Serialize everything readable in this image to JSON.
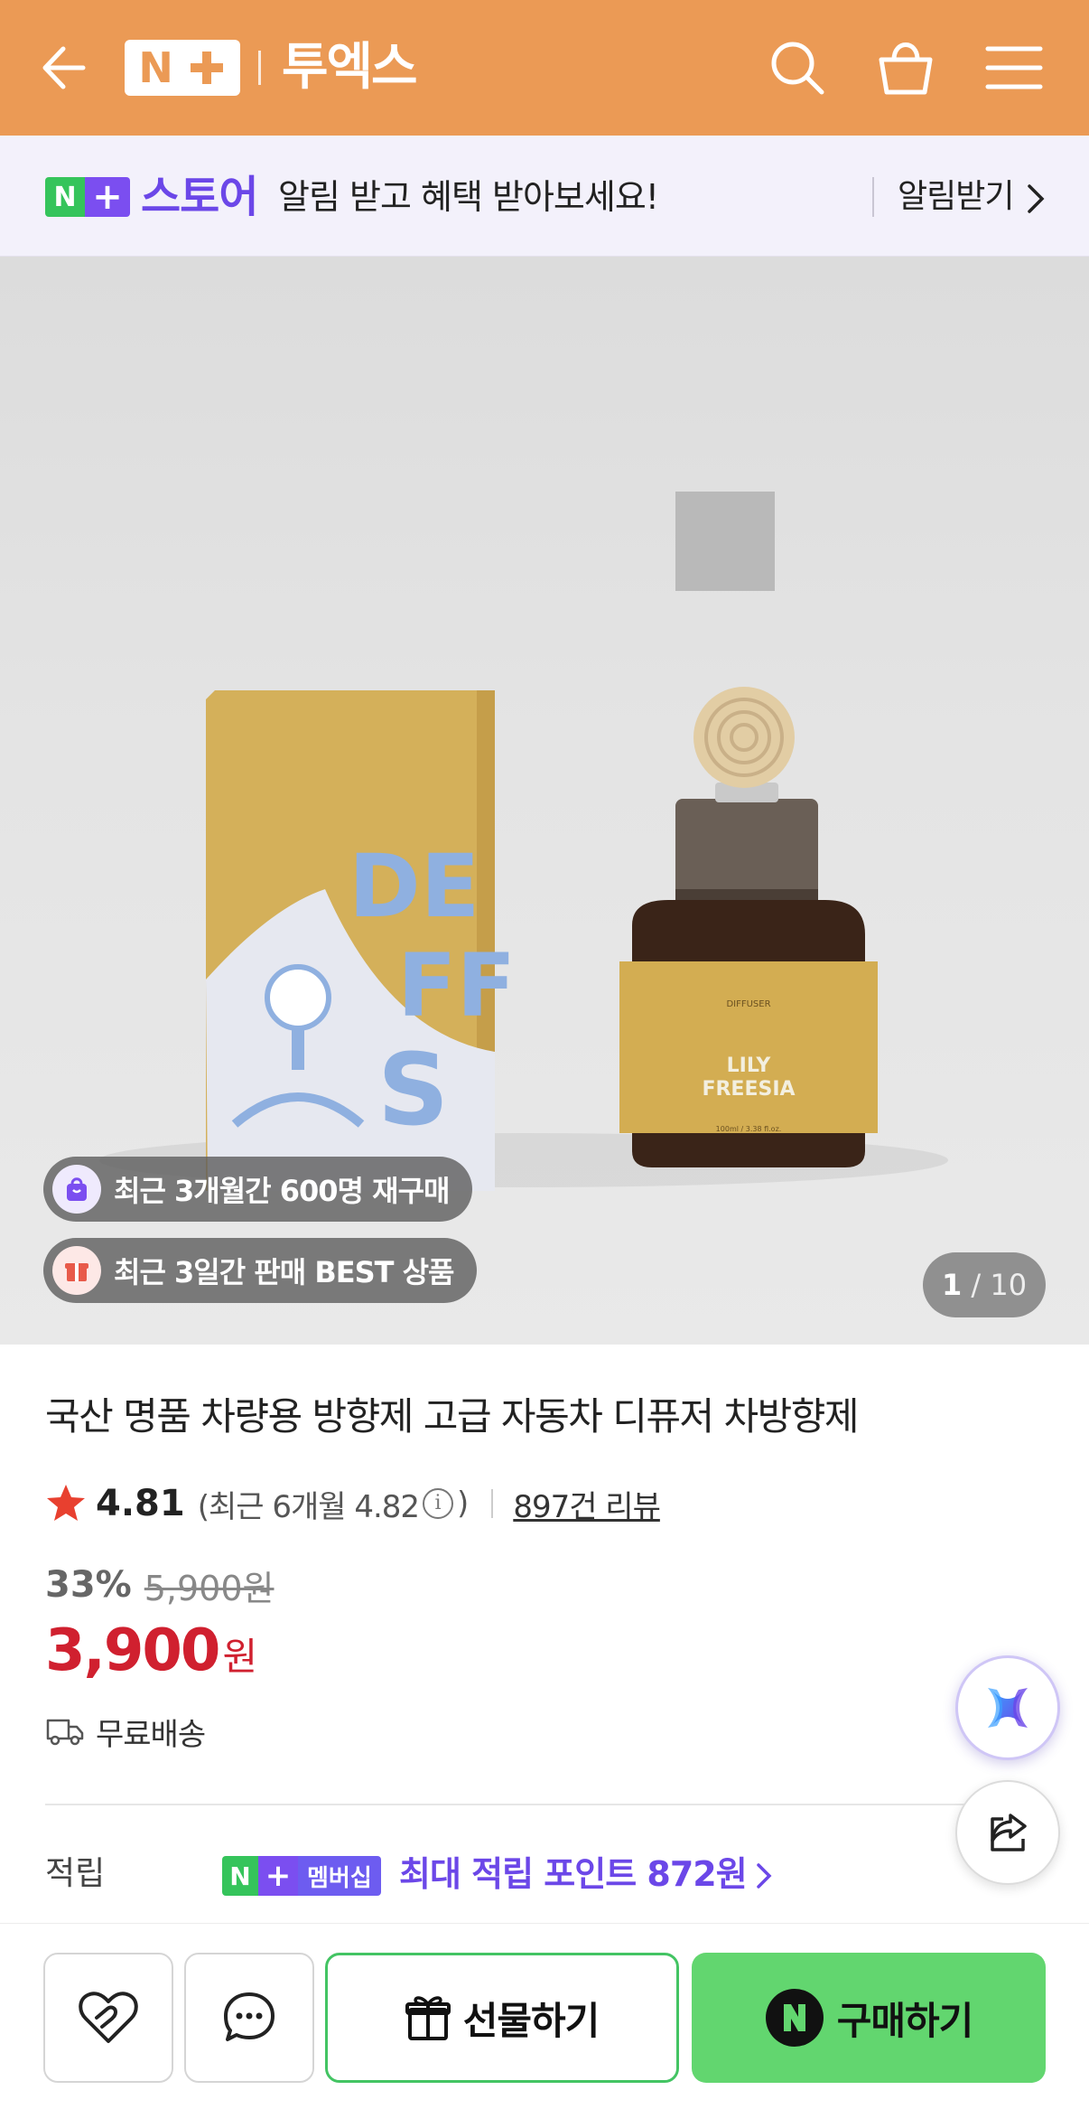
{
  "header": {
    "brand_logo_text": "N+",
    "brand_name": "투엑스",
    "bg_color": "#eb9a55"
  },
  "banner": {
    "store_logo": "N+",
    "store_name": "스토어",
    "message": "알림 받고 혜택 받아보세요!",
    "cta": "알림받기"
  },
  "gallery": {
    "box_art_text": [
      "DE",
      "FF",
      "S"
    ],
    "label_brand": "DIFFUSER",
    "label_line1": "LILY",
    "label_line2": "FREESIA",
    "label_volume": "100ml / 3.38 fl.oz.",
    "badge_repurchase": "최근 3개월간 600명 재구매",
    "badge_best": "최근 3일간 판매 BEST 상품",
    "counter_current": "1",
    "counter_total": "/ 10"
  },
  "product": {
    "title": "국산 명품 차량용 방향제 고급 자동차 디퓨저 차방향제",
    "rating": "4.81",
    "recent_rating_prefix": "(최근 6개월 4.82",
    "recent_rating_suffix": ")",
    "reviews": "897건 리뷰",
    "discount": "33%",
    "original_price": "5,900원",
    "price": "3,900",
    "currency": "원",
    "shipping": "무료배송",
    "points_label": "적립",
    "membership_badge": "멤버십",
    "points_text": "최대 적립 포인트 872원"
  },
  "actions": {
    "gift_label": "선물하기",
    "buy_label": "구매하기",
    "buy_badge": "N"
  },
  "icons": [
    "back-arrow-icon",
    "search-icon",
    "cart-icon",
    "menu-icon",
    "star-icon",
    "info-icon",
    "truck-icon",
    "ai-assistant-icon",
    "share-icon",
    "heart-wish-icon",
    "chat-bubble-icon",
    "gift-icon"
  ],
  "colors": {
    "accent_purple": "#6b47e8",
    "price_red": "#d0202f",
    "buy_green": "#62d66f",
    "naver_green": "#35c45b"
  }
}
